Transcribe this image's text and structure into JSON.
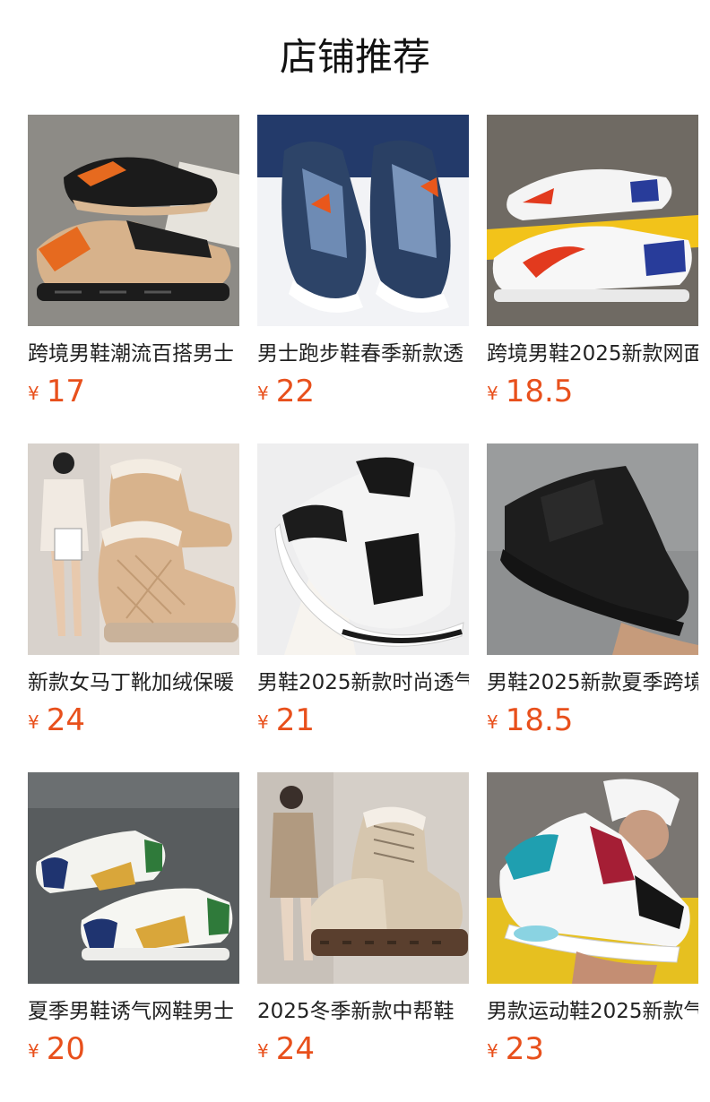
{
  "section": {
    "title": "店铺推荐"
  },
  "currency_symbol": "¥",
  "products": [
    {
      "name": "跨境男鞋潮流百搭男士",
      "price": "17",
      "image": "black-orange-beige-sneakers"
    },
    {
      "name": "男士跑步鞋春季新款透",
      "price": "22",
      "image": "navy-grey-running-shoes"
    },
    {
      "name": "跨境男鞋2025新款网面",
      "price": "18.5",
      "image": "white-red-blue-sneakers"
    },
    {
      "name": "新款女马丁靴加绒保暖",
      "price": "24",
      "image": "beige-quilted-snow-boots"
    },
    {
      "name": "男鞋2025新款时尚透气",
      "price": "21",
      "image": "white-black-chunky-sneaker"
    },
    {
      "name": "男鞋2025新款夏季跨境",
      "price": "18.5",
      "image": "black-mesh-running-shoe"
    },
    {
      "name": "夏季男鞋诱气网鞋男士",
      "price": "20",
      "image": "white-yellow-navy-slip-on"
    },
    {
      "name": "2025冬季新款中帮鞋",
      "price": "24",
      "image": "cream-fur-lined-boots"
    },
    {
      "name": "男款运动鞋2025新款气",
      "price": "23",
      "image": "white-teal-red-air-sneaker"
    }
  ],
  "colors": {
    "price": "#e8501c",
    "title": "#111111",
    "name": "#222222"
  }
}
